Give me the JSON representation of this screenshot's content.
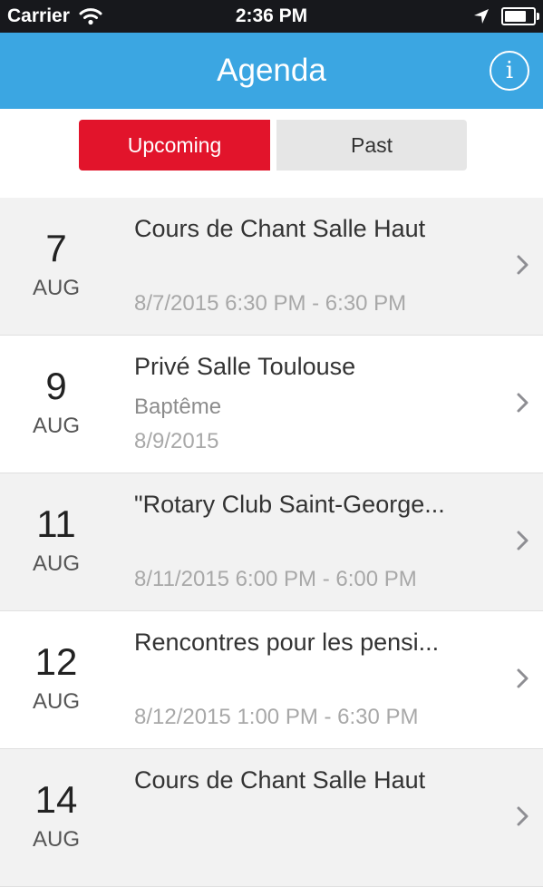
{
  "status_bar": {
    "carrier": "Carrier",
    "time": "2:36 PM",
    "wifi_icon": "wifi-icon",
    "location_icon": "location-arrow-icon",
    "battery_level": 0.9
  },
  "nav": {
    "title": "Agenda",
    "info_icon": "info-icon",
    "info_glyph": "i"
  },
  "segments": {
    "upcoming": "Upcoming",
    "past": "Past",
    "selected": "upcoming"
  },
  "colors": {
    "nav_bg": "#3ba6e2",
    "segment_active": "#e2142b",
    "segment_inactive": "#e6e6e6"
  },
  "events": [
    {
      "day": "7",
      "month": "AUG",
      "title": "Cours de Chant Salle Haut",
      "subtitle": "",
      "when": "8/7/2015 6:30 PM - 6:30 PM"
    },
    {
      "day": "9",
      "month": "AUG",
      "title": "Privé Salle Toulouse",
      "subtitle": "Baptême",
      "when": "8/9/2015"
    },
    {
      "day": "11",
      "month": "AUG",
      "title": "\"Rotary Club Saint-George...",
      "subtitle": "",
      "when": "8/11/2015 6:00 PM - 6:00 PM"
    },
    {
      "day": "12",
      "month": "AUG",
      "title": "Rencontres pour les pensi...",
      "subtitle": "",
      "when": "8/12/2015 1:00 PM - 6:30 PM"
    },
    {
      "day": "14",
      "month": "AUG",
      "title": "Cours de Chant Salle Haut",
      "subtitle": "",
      "when": ""
    }
  ]
}
